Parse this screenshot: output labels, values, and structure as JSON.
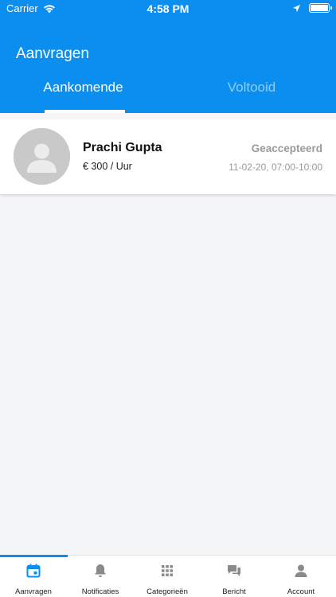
{
  "status_bar": {
    "carrier": "Carrier",
    "time": "4:58 PM"
  },
  "header": {
    "title": "Aanvragen",
    "tabs": [
      {
        "label": "Aankomende",
        "active": true
      },
      {
        "label": "Voltooid",
        "active": false
      }
    ]
  },
  "requests": [
    {
      "name": "Prachi Gupta",
      "rate": "€ 300 / Uur",
      "status": "Geaccepteerd",
      "time": "11-02-20, 07:00-10:00",
      "avatar": "default-user-avatar"
    }
  ],
  "bottom_nav": {
    "items": [
      {
        "label": "Aanvragen",
        "icon": "calendar-icon",
        "active": true
      },
      {
        "label": "Notificaties",
        "icon": "bell-icon",
        "active": false
      },
      {
        "label": "Categorieën",
        "icon": "grid-icon",
        "active": false
      },
      {
        "label": "Bericht",
        "icon": "chat-icon",
        "active": false
      },
      {
        "label": "Account",
        "icon": "person-icon",
        "active": false
      }
    ]
  },
  "colors": {
    "primary": "#0a8ef0",
    "background": "#f4f5f7",
    "muted_text": "#9a9a9a",
    "inactive_icon": "#8a8a8a"
  }
}
